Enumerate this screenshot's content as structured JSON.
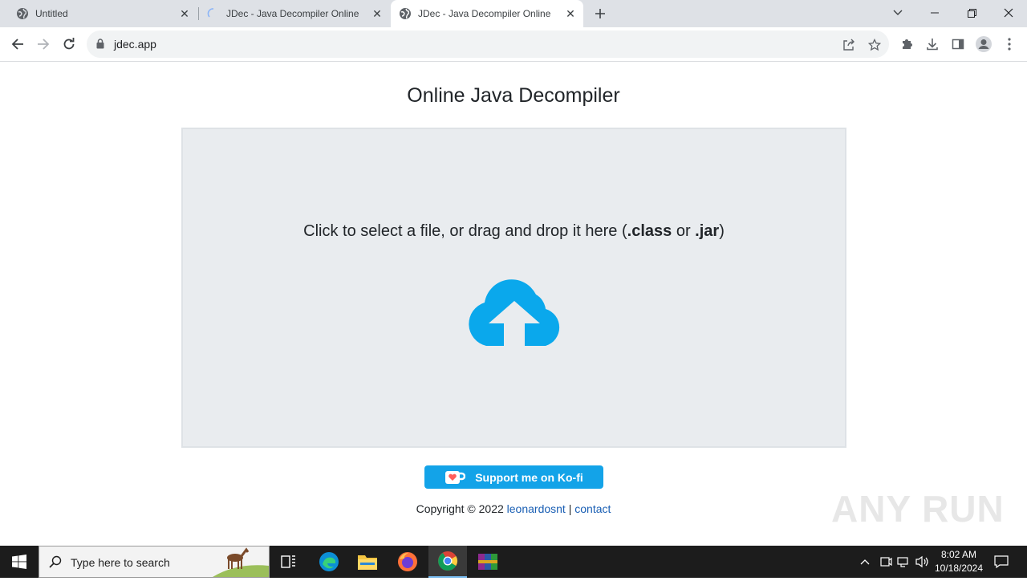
{
  "browser": {
    "tabs": [
      {
        "title": "Untitled",
        "icon": "globe-icon"
      },
      {
        "title": "JDec - Java Decompiler Online",
        "icon": "loading-spinner-icon"
      },
      {
        "title": "JDec - Java Decompiler Online",
        "icon": "globe-icon",
        "active": true
      }
    ],
    "close_glyph": "✕",
    "new_tab_glyph": "+",
    "url": "jdec.app"
  },
  "page": {
    "title": "Online Java Decompiler",
    "drop_text_pre": "Click to select a file, or drag and drop it here (",
    "drop_ext_class": ".class",
    "drop_text_or": " or ",
    "drop_ext_jar": ".jar",
    "drop_text_post": ")",
    "upload_icon": "cloud-upload-icon",
    "kofi_label": "Support me on Ko-fi",
    "footer_copyright": "Copyright © 2022 ",
    "footer_author": "leonardosnt",
    "footer_sep": " | ",
    "footer_contact": "contact",
    "watermark": "ANY RUN"
  },
  "taskbar": {
    "search_placeholder": "Type here to search",
    "time": "8:02 AM",
    "date": "10/18/2024"
  },
  "colors": {
    "accent_cloud": "#0aa8ec",
    "kofi_bg": "#13a3e8",
    "dropzone_bg": "#e9ecef"
  }
}
